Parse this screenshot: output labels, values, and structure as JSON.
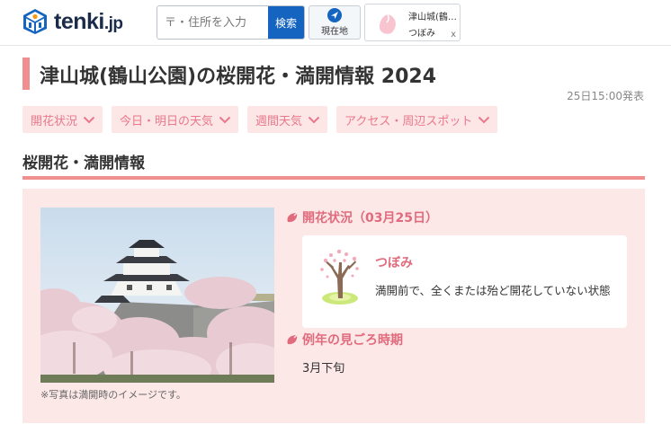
{
  "header": {
    "logo_main": "tenki",
    "logo_suffix": ".jp",
    "search_placeholder": "〒・住所を入力",
    "search_button": "検索",
    "location_button": "現在地",
    "recent": {
      "name": "津山城(鶴…",
      "status": "つぼみ",
      "close": "x"
    }
  },
  "page": {
    "title": "津山城(鶴山公園)の桜開花・満開情報 2024",
    "announced": "25日15:00発表"
  },
  "tabs": [
    {
      "label": "開花状況"
    },
    {
      "label": "今日・明日の天気"
    },
    {
      "label": "週間天気"
    },
    {
      "label": "アクセス・周辺スポット"
    }
  ],
  "section": {
    "title": "桜開花・満開情報",
    "photo_note": "※写真は満開時のイメージです。",
    "status_heading": "開花状況（03月25日）",
    "status_label": "つぼみ",
    "status_desc": "満開前で、全くまたは殆ど開花していない状態",
    "season_heading": "例年の見ごろ時期",
    "season_value": "3月下旬"
  },
  "colors": {
    "accent": "#ef8f8f",
    "pink_text": "#e06b7d",
    "panel_bg": "#fde8e8",
    "tab_bg": "#fde6e6",
    "search_btn": "#1565c0"
  },
  "icons": {
    "logo": "tenki-cube-logo-icon",
    "location": "location-arrow-icon",
    "recent": "sakura-petal-icon",
    "tab_chevron": "chevron-down-icon",
    "status_tree": "bud-tree-icon",
    "heading": "sakura-petal-icon"
  }
}
